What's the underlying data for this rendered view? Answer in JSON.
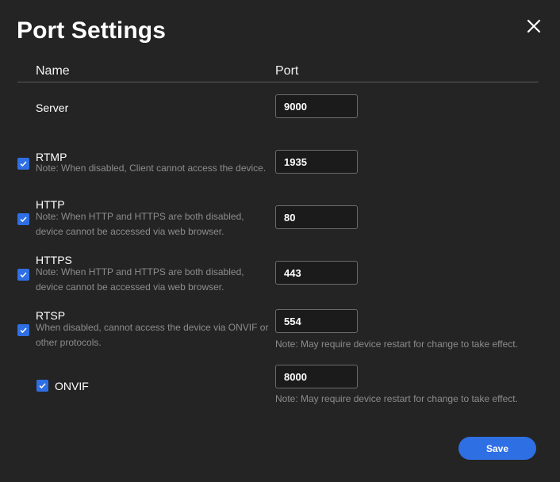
{
  "dialog": {
    "title": "Port Settings",
    "close_icon": "close-icon"
  },
  "columns": {
    "name": "Name",
    "port": "Port"
  },
  "rows": [
    {
      "name": "Server",
      "note": [],
      "port": "9000",
      "checked": null,
      "port_note": ""
    },
    {
      "name": "RTMP",
      "note": [
        "Note: When disabled, Client cannot access the device."
      ],
      "port": "1935",
      "checked": true,
      "port_note": ""
    },
    {
      "name": "HTTP",
      "note": [
        "Note: When HTTP and HTTPS are both disabled,",
        "device cannot be accessed via web browser."
      ],
      "port": "80",
      "checked": true,
      "port_note": ""
    },
    {
      "name": "HTTPS",
      "note": [
        "Note: When HTTP and HTTPS are both disabled,",
        "device cannot be accessed via web browser."
      ],
      "port": "443",
      "checked": true,
      "port_note": ""
    },
    {
      "name": "RTSP",
      "note": [
        "When disabled, cannot access the device via ONVIF or",
        "other protocols."
      ],
      "port": "554",
      "checked": true,
      "port_note": "Note: May require device restart for change to take effect."
    },
    {
      "name": "ONVIF",
      "note": [],
      "port": "8000",
      "checked": true,
      "port_note": "Note: May require device restart for change to take effect."
    }
  ],
  "save_label": "Save",
  "colors": {
    "accent": "#2f6fe4",
    "background": "#242424",
    "note_text": "#8c8c8c"
  }
}
